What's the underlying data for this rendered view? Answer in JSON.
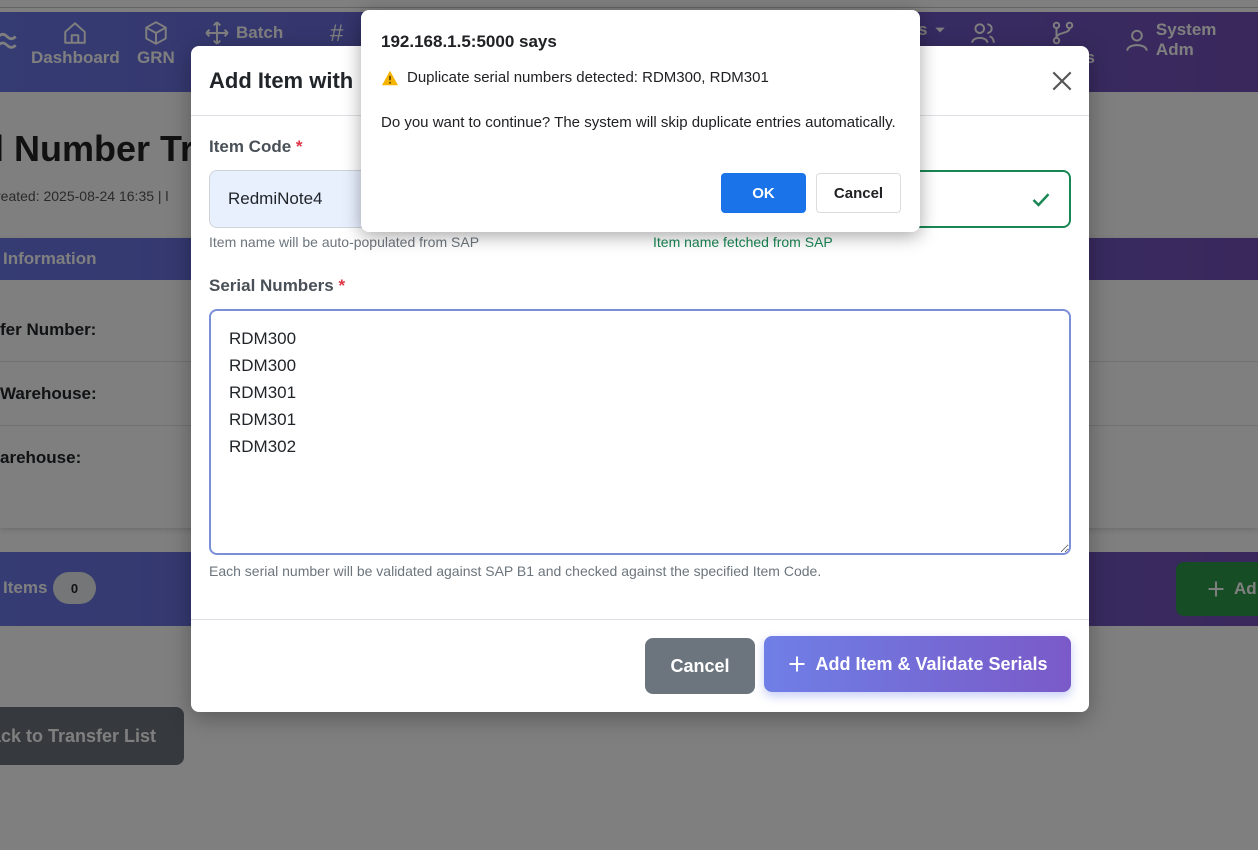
{
  "navbar": {
    "items": [
      {
        "label": "Dashboard",
        "icon": "house-icon"
      },
      {
        "label": "GRN",
        "icon": "box-icon"
      },
      {
        "label": "Batch",
        "icon": "move-icon"
      },
      {
        "label": "#",
        "icon": "hash-icon"
      },
      {
        "label": "s",
        "icon": "caret-down-icon"
      },
      {
        "label": "es",
        "icon": "branch-icon"
      },
      {
        "label": "System Adm",
        "icon": "user-icon"
      }
    ]
  },
  "page": {
    "title": "l Number Tr",
    "meta": "reated: 2025-08-24 16:35 | l",
    "info_header": "Information",
    "rows": [
      "fer Number:",
      "Warehouse:",
      "arehouse:"
    ],
    "items_label": "Items",
    "items_count": "0",
    "add_button": "Ad",
    "back_button": "Back to Transfer List"
  },
  "modal": {
    "title": "Add Item with",
    "item_code_label": "Item Code",
    "required_mark": "*",
    "item_code_value": "RedmiNote4",
    "item_code_help": "Item name will be auto-populated from SAP",
    "item_name_help": "Item name fetched from SAP",
    "serials_label": "Serial Numbers",
    "serials_value": "RDM300\nRDM300\nRDM301\nRDM301\nRDM302",
    "serials_help": "Each serial number will be validated against SAP B1 and checked against the specified Item Code.",
    "cancel_label": "Cancel",
    "submit_label": "Add Item & Validate Serials"
  },
  "dialog": {
    "title": "192.168.1.5:5000 says",
    "warning": "Duplicate serial numbers detected: RDM300, RDM301",
    "message": "Do you want to continue? The system will skip duplicate entries automatically.",
    "ok_label": "OK",
    "cancel_label": "Cancel"
  },
  "colors": {
    "accent_gradient_start": "#6b78e6",
    "accent_gradient_end": "#7450b8",
    "success": "#198754",
    "danger": "#dc3545",
    "dialog_primary": "#1a73e8"
  }
}
